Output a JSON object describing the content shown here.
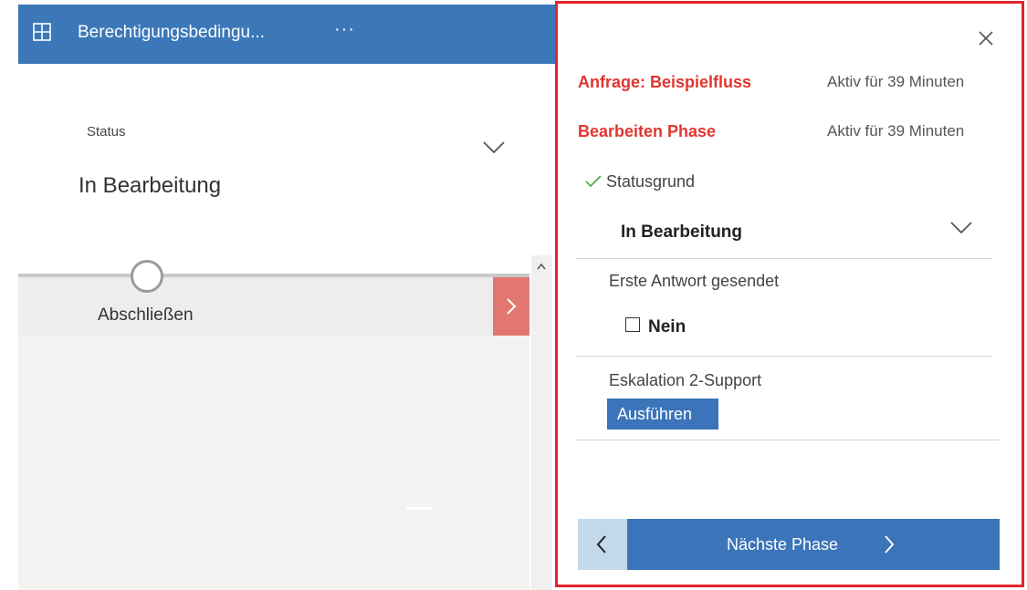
{
  "app_bar": {
    "title": "Berechtigungsbedingu...",
    "more": "···",
    "grid_icon": "grid-icon",
    "background": "#3c78b8"
  },
  "form": {
    "status_label": "Status",
    "status_value": "In Bearbeitung",
    "chevron_icon": "chevron-down-icon"
  },
  "process_bar": {
    "stage_label": "Abschließen",
    "next_icon": "chevron-right-icon",
    "next_color": "#e1776f"
  },
  "flyout": {
    "border_color": "#e3232d",
    "close_icon": "close-icon",
    "request": {
      "name": "Anfrage: Beispielfluss",
      "time": "Aktiv für 39 Minuten"
    },
    "phase": {
      "name": "Bearbeiten Phase",
      "time": "Aktiv für 39 Minuten"
    },
    "accent_color": "#e0362f",
    "fields": {
      "statusgrund": {
        "label": "Statusgrund",
        "value": "In Bearbeitung",
        "icon": "check-icon"
      },
      "erste_antwort": {
        "label": "Erste Antwort gesendet",
        "value": "Nein"
      },
      "eskalation": {
        "label": "Eskalation 2-Support",
        "button": "Ausführen"
      }
    },
    "navigation": {
      "prev_icon": "chevron-left-icon",
      "next_label": "Nächste Phase",
      "next_icon": "chevron-right-icon",
      "button_color": "#3b74b8"
    }
  }
}
